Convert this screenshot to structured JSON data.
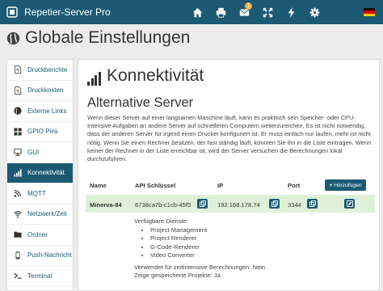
{
  "navbar": {
    "brand": "Repetier-Server Pro",
    "messages_badge": "1",
    "icons": [
      "home-icon",
      "print-icon",
      "messages-icon",
      "fullscreen-icon",
      "bolt-icon",
      "gear-icon"
    ],
    "flag_colors": [
      "#000000",
      "#dd0000",
      "#ffce00"
    ]
  },
  "page": {
    "title": "Globale Einstellungen"
  },
  "sidebar": {
    "items": [
      {
        "label": "Druckberichte",
        "icon": "file-pdf-icon"
      },
      {
        "label": "Druckkosten",
        "icon": "file-pdf-icon"
      },
      {
        "label": "Externe Links",
        "icon": "globe-icon"
      },
      {
        "label": "GPIO Pins",
        "icon": "grid-icon"
      },
      {
        "label": "GUI",
        "icon": "monitor-icon"
      },
      {
        "label": "Konnektivität",
        "icon": "signal-icon",
        "active": true
      },
      {
        "label": "MQTT",
        "icon": "mqtt-icon"
      },
      {
        "label": "Netzwerk/Zeit",
        "icon": "wifi-icon"
      },
      {
        "label": "Ordner",
        "icon": "folder-icon"
      },
      {
        "label": "Push-Nachricht",
        "icon": "phone-icon"
      },
      {
        "label": "Terminal",
        "icon": "terminal-icon"
      }
    ]
  },
  "main": {
    "title": "Konnektivität",
    "subtitle": "Alternative Server",
    "description": "Wenn dieser Server auf einer langsamen Maschine läuft, kann es praktisch sein Speicher- oder CPU-Intensive Aufgaben an andere Server auf schnelleren Computern weiterzureichen. Es ist nicht notwendig, dass der anderen Server für irgend einen Drucker konfiguriert ist. Er muss einfach nur laufen, mehr ist nicht nötig. Wenn Sie einen Rechner besitzen, der fast ständig läuft, könnten Sie ihn in die Liste eintragen. Wenn keiner der Rechner in der Liste erreichbar ist, wird der Server versuchen die Berechnungen lokal durchzuführen.",
    "table": {
      "headers": {
        "name": "Name",
        "api_key": "API Schlüssel",
        "ip": "IP",
        "port": "Port"
      },
      "add_button": "Hinzufügen",
      "row": {
        "name": "Minerva-84",
        "api_key": "6738ca7b-c1cb-45f5",
        "ip": "192.168.178.74",
        "port": "3344"
      }
    },
    "details": {
      "services_label": "Verfügbare Dienste:",
      "services": [
        "Project Management",
        "Project Renderer",
        "G-Code-Renderer",
        "Video Converter"
      ],
      "time_intensive": "Verwendet für zeitintensive Berechnungen: Nein",
      "show_projects": "Zeige gespeicherte Projekte: Ja"
    }
  }
}
